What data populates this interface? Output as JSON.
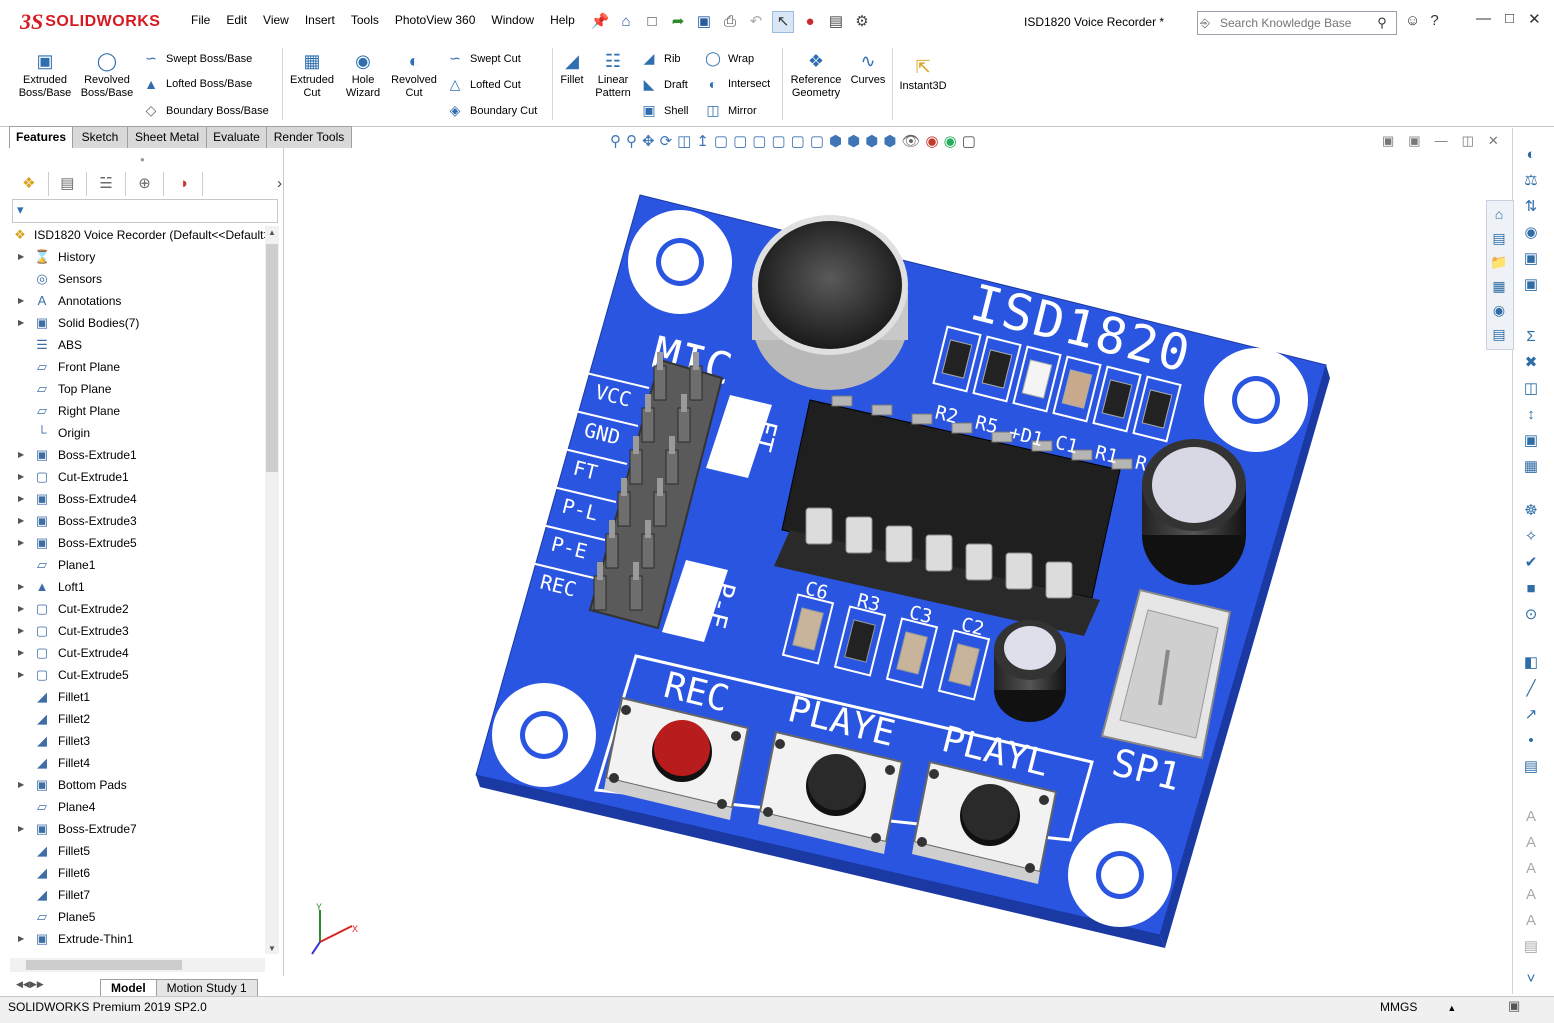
{
  "app": {
    "brand_ds": "3S",
    "brand_name": "SOLIDWORKS",
    "document_title": "ISD1820 Voice Recorder *",
    "search_placeholder": "Search Knowledge Base"
  },
  "menu": [
    "File",
    "Edit",
    "View",
    "Insert",
    "Tools",
    "PhotoView 360",
    "Window",
    "Help"
  ],
  "commands": {
    "extruded_boss": "Extruded Boss/Base",
    "revolved_boss": "Revolved Boss/Base",
    "swept_boss": "Swept Boss/Base",
    "lofted_boss": "Lofted Boss/Base",
    "boundary_boss": "Boundary Boss/Base",
    "extruded_cut": "Extruded Cut",
    "hole_wizard": "Hole Wizard",
    "revolved_cut": "Revolved Cut",
    "swept_cut": "Swept Cut",
    "lofted_cut": "Lofted Cut",
    "boundary_cut": "Boundary Cut",
    "fillet": "Fillet",
    "linear_pattern": "Linear Pattern",
    "rib": "Rib",
    "draft": "Draft",
    "shell": "Shell",
    "wrap": "Wrap",
    "intersect": "Intersect",
    "mirror": "Mirror",
    "reference_geometry": "Reference Geometry",
    "curves": "Curves",
    "instant3d": "Instant3D"
  },
  "tabs": [
    "Features",
    "Sketch",
    "Sheet Metal",
    "Evaluate",
    "Render Tools"
  ],
  "tree": {
    "root": "ISD1820 Voice Recorder  (Default<<Default>",
    "items": [
      {
        "label": "History",
        "exp": true,
        "icon": "history-icon"
      },
      {
        "label": "Sensors",
        "exp": false,
        "icon": "sensor-icon"
      },
      {
        "label": "Annotations",
        "exp": true,
        "icon": "annotation-icon"
      },
      {
        "label": "Solid Bodies(7)",
        "exp": true,
        "icon": "solid-bodies-icon"
      },
      {
        "label": "ABS",
        "exp": false,
        "icon": "material-icon"
      },
      {
        "label": "Front Plane",
        "exp": false,
        "icon": "plane-icon"
      },
      {
        "label": "Top Plane",
        "exp": false,
        "icon": "plane-icon"
      },
      {
        "label": "Right Plane",
        "exp": false,
        "icon": "plane-icon"
      },
      {
        "label": "Origin",
        "exp": false,
        "icon": "origin-icon"
      },
      {
        "label": "Boss-Extrude1",
        "exp": true,
        "icon": "boss-extrude-icon"
      },
      {
        "label": "Cut-Extrude1",
        "exp": true,
        "icon": "cut-extrude-icon"
      },
      {
        "label": "Boss-Extrude4",
        "exp": true,
        "icon": "boss-extrude-icon"
      },
      {
        "label": "Boss-Extrude3",
        "exp": true,
        "icon": "boss-extrude-icon"
      },
      {
        "label": "Boss-Extrude5",
        "exp": true,
        "icon": "boss-extrude-icon"
      },
      {
        "label": "Plane1",
        "exp": false,
        "icon": "plane-icon"
      },
      {
        "label": "Loft1",
        "exp": true,
        "icon": "loft-icon"
      },
      {
        "label": "Cut-Extrude2",
        "exp": true,
        "icon": "cut-extrude-icon"
      },
      {
        "label": "Cut-Extrude3",
        "exp": true,
        "icon": "cut-extrude-icon"
      },
      {
        "label": "Cut-Extrude4",
        "exp": true,
        "icon": "cut-extrude-icon"
      },
      {
        "label": "Cut-Extrude5",
        "exp": true,
        "icon": "cut-extrude-icon"
      },
      {
        "label": "Fillet1",
        "exp": false,
        "icon": "fillet-icon"
      },
      {
        "label": "Fillet2",
        "exp": false,
        "icon": "fillet-icon"
      },
      {
        "label": "Fillet3",
        "exp": false,
        "icon": "fillet-icon"
      },
      {
        "label": "Fillet4",
        "exp": false,
        "icon": "fillet-icon"
      },
      {
        "label": "Bottom Pads",
        "exp": true,
        "icon": "boss-extrude-icon"
      },
      {
        "label": "Plane4",
        "exp": false,
        "icon": "plane-icon"
      },
      {
        "label": "Boss-Extrude7",
        "exp": true,
        "icon": "boss-extrude-icon"
      },
      {
        "label": "Fillet5",
        "exp": false,
        "icon": "fillet-icon"
      },
      {
        "label": "Fillet6",
        "exp": false,
        "icon": "fillet-icon"
      },
      {
        "label": "Fillet7",
        "exp": false,
        "icon": "fillet-icon"
      },
      {
        "label": "Plane5",
        "exp": false,
        "icon": "plane-icon"
      },
      {
        "label": "Extrude-Thin1",
        "exp": true,
        "icon": "boss-extrude-icon"
      }
    ]
  },
  "bottom_tabs": [
    "Model",
    "Motion Study 1"
  ],
  "status": {
    "product": "SOLIDWORKS Premium 2019 SP2.0",
    "units": "MMGS"
  },
  "board": {
    "title": "ISD1820",
    "mic_label": "MIC",
    "pins": [
      "VCC",
      "GND",
      "FT",
      "P-L",
      "P-E",
      "REC"
    ],
    "jumper_labels": [
      "FT",
      "P-E"
    ],
    "top_components": [
      "R2",
      "R5",
      "+D1",
      "C1",
      "R1",
      "R4"
    ],
    "mid_components": [
      "C6",
      "R3",
      "C3",
      "C2"
    ],
    "buttons": [
      "REC",
      "PLAYE",
      "PLAYL"
    ],
    "speaker_label": "SP1",
    "colors": {
      "pcb": "#2a55e0",
      "pcb_edge": "#1b39a3",
      "silk": "#ffffff",
      "button_red": "#b81c1c"
    }
  },
  "triad_axes": {
    "x": "X",
    "y": "Y"
  }
}
